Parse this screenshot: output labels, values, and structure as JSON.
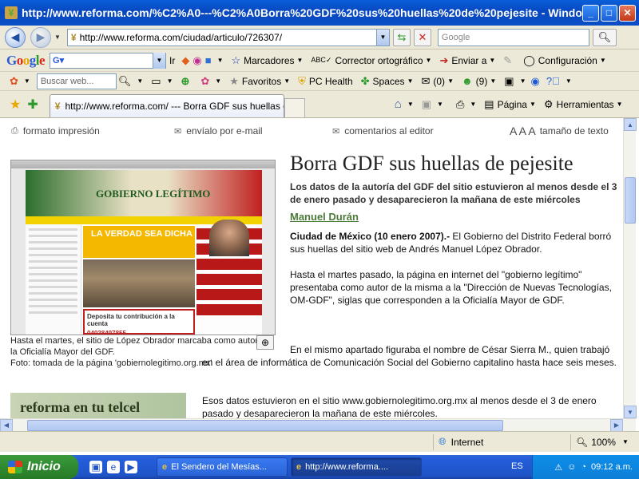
{
  "window": {
    "title": "http://www.reforma.com/%C2%A0---%C2%A0Borra%20GDF%20sus%20huellas%20de%20pejesite - Windows In...",
    "minimize": "_",
    "maximize": "□",
    "close": "✕"
  },
  "address_bar": {
    "url": "http://www.reforma.com/ciudad/articulo/726307/",
    "search_placeholder": "Google"
  },
  "google_toolbar": {
    "logo": "Google",
    "search_go": "Ir",
    "bookmarks": "Marcadores",
    "spellcheck": "Corrector ortográfico",
    "send": "Enviar a",
    "settings": "Configuración"
  },
  "links_bar": {
    "search_placeholder": "Buscar web...",
    "favorites": "Favoritos",
    "pc_health": "PC Health",
    "spaces": "Spaces",
    "mail_count": "(0)",
    "people_count": "(9)"
  },
  "tab_bar": {
    "active_tab": "http://www.reforma.com/ --- Borra GDF sus huellas d...",
    "page_menu": "Página",
    "tools_menu": "Herramientas"
  },
  "utilities": {
    "print": "formato impresión",
    "email": "envíalo por e-mail",
    "comments": "comentarios al editor",
    "text_size_glyphs": "A A A",
    "text_size": "tamaño de texto"
  },
  "figure": {
    "banner_text": "GOBIERNO LEGÍTIMO",
    "truth_text": "LA VERDAD SEA DICHA",
    "donate_text": "Deposita tu contribución a la cuenta",
    "donate_number": "04038497855",
    "caption": "Hasta el martes, el sitio de López Obrador marcaba como autor a la Oficialía Mayor del GDF.",
    "credit": "Foto: tomada de la página 'gobiernolegitimo.org.mx'"
  },
  "promo_banner": "reforma en tu telcel",
  "article": {
    "headline": "Borra GDF sus huellas de pejesite",
    "deck": "Los datos de la autoría del GDF del sitio estuvieron al menos desde el 3 de enero pasado y desaparecieron la mañana de este miércoles",
    "author": "Manuel Durán",
    "dateline": "Ciudad de México  (10 enero 2007).-",
    "p1": " El Gobierno del Distrito Federal borró sus huellas del sitio web de Andrés Manuel López Obrador.",
    "p2": "Hasta el martes pasado, la página en internet del \"gobierno legítimo\" presentaba como autor de la misma a la \"Dirección de Nuevas Tecnologías, OM-GDF\", siglas que corresponden a la Oficialía Mayor de GDF.",
    "p3": "En el mismo apartado figuraba el nombre de César Sierra M., quien trabajó en el área de informática de Comunicación Social del Gobierno capitalino hasta hace seis meses.",
    "p4": "Esos datos estuvieron en el sitio www.gobiernolegitimo.org.mx al menos desde el 3 de enero pasado y desaparecieron la mañana de este miércoles."
  },
  "status_bar": {
    "zone": "Internet",
    "zoom": "100%"
  },
  "taskbar": {
    "start": "Inicio",
    "task1": "El Sendero del Mesías...",
    "task2": "http://www.reforma....",
    "language": "ES",
    "clock": "09:12 a.m."
  }
}
